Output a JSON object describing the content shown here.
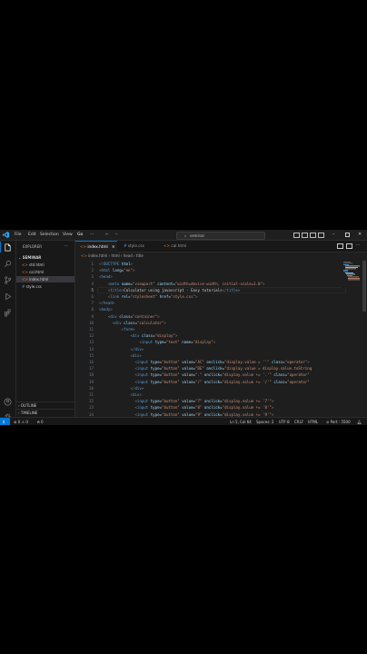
{
  "menu": [
    "File",
    "Edit",
    "Selection",
    "View",
    "Go",
    "···"
  ],
  "search": {
    "text": "seminar"
  },
  "sidebar": {
    "title": "EXPLORER",
    "section": "SEMINAR",
    "items": [
      {
        "label": "std.html",
        "badge": ""
      },
      {
        "label": "cal.html",
        "badge": ""
      },
      {
        "label": "index.html",
        "badge": ""
      },
      {
        "label": "style.css",
        "badge": ""
      }
    ],
    "outline": "OUTLINE",
    "timeline": "TIMELINE"
  },
  "tabs": [
    {
      "label": "index.html",
      "active": true
    },
    {
      "label": "style.css",
      "active": false
    },
    {
      "label": "cal.html",
      "active": false
    }
  ],
  "breadcrumb": [
    "index.html",
    "html",
    "head",
    "title"
  ],
  "code_lines": [
    {
      "n": "1",
      "html": "<span class='p'>&lt;!</span><span class='t'>DOCTYPE</span> <span class='a'>html</span><span class='p'>&gt;</span>"
    },
    {
      "n": "2",
      "html": "<span class='p'>&lt;</span><span class='t'>html</span> <span class='a'>lang</span>=<span class='s'>\"en\"</span><span class='p'>&gt;</span>"
    },
    {
      "n": "3",
      "html": "<span class='p'>&lt;</span><span class='t'>head</span><span class='p'>&gt;</span>"
    },
    {
      "n": "4",
      "html": "    <span class='p'>&lt;</span><span class='t'>meta</span> <span class='a'>name</span>=<span class='s'>\"viewport\"</span> <span class='a'>content</span>=<span class='s'>\"width=device-width, initial-scale=1.0\"</span><span class='p'>&gt;</span>"
    },
    {
      "n": "5",
      "html": "    <span class='p'>&lt;</span><span class='t'>title</span><span class='p'>&gt;</span>Calculator using javascript - Easy tutorials<span class='p'>&lt;/</span><span class='t'>title</span><span class='p'>&gt;</span>"
    },
    {
      "n": "6",
      "html": "    <span class='p'>&lt;</span><span class='t'>link</span> <span class='a'>rel</span>=<span class='s'>\"stylesheet\"</span> <span class='a'>href</span>=<span class='s'>\"style.css\"</span><span class='p'>&gt;</span>"
    },
    {
      "n": "7",
      "html": "<span class='p'>&lt;/</span><span class='t'>head</span><span class='p'>&gt;</span>"
    },
    {
      "n": "8",
      "html": "<span class='p'>&lt;</span><span class='t'>body</span><span class='p'>&gt;</span>"
    },
    {
      "n": "9",
      "html": "    <span class='p'>&lt;</span><span class='t'>div</span> <span class='a'>class</span>=<span class='s'>\"container\"</span><span class='p'>&gt;</span>"
    },
    {
      "n": "10",
      "html": "      <span class='p'>&lt;</span><span class='t'>div</span> <span class='a'>class</span>=<span class='s'>\"calculator\"</span><span class='p'>&gt;</span>"
    },
    {
      "n": "11",
      "html": "          <span class='p'>&lt;</span><span class='t'>form</span><span class='p'>&gt;</span>"
    },
    {
      "n": "12",
      "html": "              <span class='p'>&lt;</span><span class='t'>div</span> <span class='a'>class</span>=<span class='s'>\"display\"</span><span class='p'>&gt;</span>"
    },
    {
      "n": "13",
      "html": "                  <span class='p'>&lt;</span><span class='t'>input</span> <span class='a'>type</span>=<span class='s'>\"text\"</span> <span class='a'>name</span>=<span class='s'>\"display\"</span><span class='p'>&gt;</span>"
    },
    {
      "n": "14",
      "html": "              <span class='p'>&lt;/</span><span class='t'>div</span><span class='p'>&gt;</span>"
    },
    {
      "n": "15",
      "html": "              <span class='p'>&lt;</span><span class='t'>div</span><span class='p'>&gt;</span>"
    },
    {
      "n": "16",
      "html": "                <span class='p'>&lt;</span><span class='t'>input</span> <span class='a'>type</span>=<span class='s'>\"button\"</span> <span class='a'>value</span>=<span class='s'>\"AC\"</span> <span class='a'>onclick</span>=<span class='s'>\"display.value = ''\"</span> <span class='a'>class</span>=<span class='s'>\"operator\"</span><span class='p'>&gt;</span>"
    },
    {
      "n": "17",
      "html": "                <span class='p'>&lt;</span><span class='t'>input</span> <span class='a'>type</span>=<span class='s'>\"button\"</span> <span class='a'>value</span>=<span class='s'>\"DE\"</span> <span class='a'>onclick</span>=<span class='s'>\"display.value = display.value.toString</span>"
    },
    {
      "n": "18",
      "html": "                <span class='p'>&lt;</span><span class='t'>input</span> <span class='a'>type</span>=<span class='s'>\"button\"</span> <span class='a'>value</span>=<span class='s'>\".\"</span> <span class='a'>onclick</span>=<span class='s'>\"display.value += '.'\"</span> <span class='a'>class</span>=<span class='s'>\"operator\"</span>"
    },
    {
      "n": "19",
      "html": "                <span class='p'>&lt;</span><span class='t'>input</span> <span class='a'>type</span>=<span class='s'>\"button\"</span> <span class='a'>value</span>=<span class='s'>\"/\"</span> <span class='a'>onclick</span>=<span class='s'>\"display.value += '/'\"</span> <span class='a'>class</span>=<span class='s'>\"operator\"</span>"
    },
    {
      "n": "20",
      "html": "              <span class='p'>&lt;/</span><span class='t'>div</span><span class='p'>&gt;</span>"
    },
    {
      "n": "21",
      "html": "              <span class='p'>&lt;</span><span class='t'>div</span><span class='p'>&gt;</span>"
    },
    {
      "n": "22",
      "html": "                <span class='p'>&lt;</span><span class='t'>input</span> <span class='a'>type</span>=<span class='s'>\"button\"</span> <span class='a'>value</span>=<span class='s'>\"7\"</span> <span class='a'>onclick</span>=<span class='s'>\"display.value += '7'\"</span><span class='p'>&gt;</span>"
    },
    {
      "n": "23",
      "html": "                <span class='p'>&lt;</span><span class='t'>input</span> <span class='a'>type</span>=<span class='s'>\"button\"</span> <span class='a'>value</span>=<span class='s'>\"8\"</span> <span class='a'>onclick</span>=<span class='s'>\"display.value += '8'\"</span><span class='p'>&gt;</span>"
    },
    {
      "n": "24",
      "html": "                <span class='p'>&lt;</span><span class='t'>input</span> <span class='a'>type</span>=<span class='s'>\"button\"</span> <span class='a'>value</span>=<span class='s'>\"9\"</span> <span class='a'>onclick</span>=<span class='s'>\"display.value += '9'\"</span><span class='p'>&gt;</span>"
    }
  ],
  "current_line": "5",
  "status": {
    "errors": "0",
    "warnings": "0",
    "ports": "0",
    "cursor": "Ln 5, Col 64",
    "spaces": "Spaces: 2",
    "encoding": "UTF-8",
    "eol": "CRLF",
    "language": "HTML",
    "port": "Port : 5500"
  },
  "colors": {
    "accent": "#0078d4",
    "bg": "#1e1e1e",
    "sidebar": "#181818"
  }
}
